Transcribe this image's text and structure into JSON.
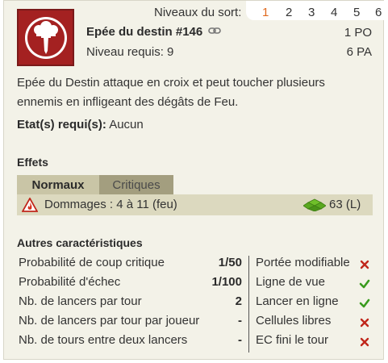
{
  "spell": {
    "levels_label": "Niveaux du sort:",
    "levels": [
      "1",
      "2",
      "3",
      "4",
      "5",
      "6"
    ],
    "active_level": "1",
    "name": "Epée du destin #146",
    "required_level": "Niveau requis: 9",
    "cost_po": "1 PO",
    "cost_pa": "6 PA",
    "description": "Epée du Destin attaque en croix et peut toucher plusieurs ennemis en infligeant des dégâts de Feu.",
    "states_label": "Etat(s) requi(s):",
    "states_value": "Aucun"
  },
  "effects": {
    "title": "Effets",
    "tabs": [
      "Normaux",
      "Critiques"
    ],
    "active_tab": "Normaux",
    "rows": [
      {
        "text": "Dommages : 4 à 11 (feu)",
        "area": "63 (L)",
        "icon": "fire-icon",
        "area_icon": "cross-area-icon"
      }
    ]
  },
  "characteristics": {
    "title": "Autres caractéristiques",
    "left": [
      {
        "label": "Probabilité de coup critique",
        "value": "1/50"
      },
      {
        "label": "Probabilité d'échec",
        "value": "1/100"
      },
      {
        "label": "Nb. de lancers par tour",
        "value": "2"
      },
      {
        "label": "Nb. de lancers par tour par joueur",
        "value": "-"
      },
      {
        "label": "Nb. de tours entre deux lancers",
        "value": "-"
      }
    ],
    "right": [
      {
        "label": "Portée modifiable",
        "state": "no"
      },
      {
        "label": "Ligne de vue",
        "state": "yes"
      },
      {
        "label": "Lancer en ligne",
        "state": "yes"
      },
      {
        "label": "Cellules libres",
        "state": "no"
      },
      {
        "label": "EC fini le tour",
        "state": "no"
      }
    ]
  },
  "colors": {
    "accent": "#e06a1f",
    "icon_frame": "#a42121",
    "check": "#3a9b1e",
    "cross": "#c0271b"
  }
}
